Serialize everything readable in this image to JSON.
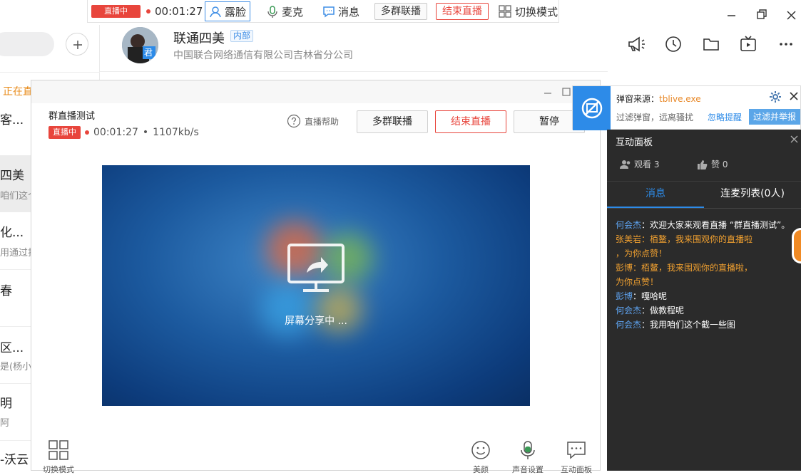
{
  "topbar": {
    "live_badge": "直播中",
    "timer": "00:01:27",
    "face_label": "露脸",
    "mic_label": "麦克",
    "msg_label": "消息",
    "multi_group": "多群联播",
    "end_live": "结束直播",
    "switch_mode": "切换模式"
  },
  "left": {
    "ongoing": "正在直",
    "conversations": [
      {
        "name": "客...",
        "sub": ""
      },
      {
        "name": "四美",
        "sub": "咱们这个"
      },
      {
        "name": "化...",
        "sub": "用通过扫"
      },
      {
        "name": "春",
        "sub": ""
      },
      {
        "name": "区...",
        "sub": "是(杨小"
      },
      {
        "name": "明",
        "sub": "阿"
      },
      {
        "name": "-沃云",
        "sub": ""
      }
    ]
  },
  "chat": {
    "title": "联通四美",
    "tag": "内部",
    "org": "中国联合网络通信有限公司吉林省分公司",
    "avatar_text": "君"
  },
  "live": {
    "name": "群直播测试",
    "badge": "直播中",
    "timer": "00:01:27",
    "separator": "•",
    "bitrate": "1107kb/s",
    "help": "直播帮助",
    "multi_group": "多群联播",
    "end_live": "结束直播",
    "pause": "暂停",
    "sharing": "屏幕分享中 ...",
    "switch_mode": "切换模式",
    "beauty": "美颜",
    "sound": "声音设置",
    "interact": "互动面板"
  },
  "popup": {
    "source_label": "弹窗来源：",
    "source_exe": "tblive.exe",
    "filter_text": "过滤弹窗，远离骚扰",
    "ignore": "忽略提醒",
    "report": "过滤并举报"
  },
  "panel": {
    "title": "互动面板",
    "viewers": "观看 3",
    "likes": "赞 0",
    "tab_messages": "消息",
    "tab_lianmai": "连麦列表(0人)",
    "messages": [
      {
        "name": "何会杰",
        "text": "：欢迎大家来观看直播 “群直播测试”。",
        "style": "blue"
      },
      {
        "name": "张美岩",
        "text": "：栢鳌，我来围观你的直播啦",
        "style": "orange"
      },
      {
        "name": "",
        "text": "，为你点赞！",
        "style": "orange"
      },
      {
        "name": "彭博",
        "text": "：栢鳌，我来围观你的直播啦，",
        "style": "orange"
      },
      {
        "name": "",
        "text": "为你点赞！",
        "style": "orange"
      },
      {
        "name": "彭博",
        "text": "：嘎哈呢",
        "style": "blue"
      },
      {
        "name": "何会杰",
        "text": "：做教程呢",
        "style": "blue"
      },
      {
        "name": "何会杰",
        "text": "：我用咱们这个截一些图",
        "style": "blue"
      }
    ]
  },
  "colors": {
    "accent_red": "#e8453c",
    "accent_blue": "#2d8be8",
    "panel_bg": "#2b2b2b",
    "highlight_orange": "#f0a030"
  }
}
